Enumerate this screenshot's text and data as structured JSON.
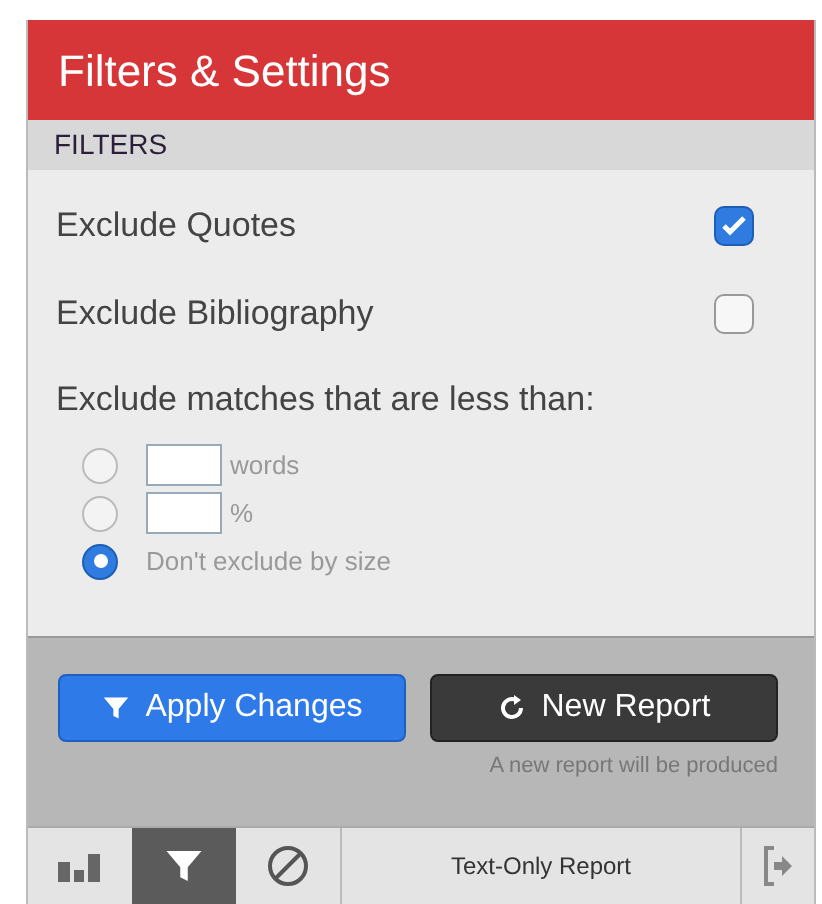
{
  "header": {
    "title": "Filters & Settings"
  },
  "section": {
    "title": "FILTERS"
  },
  "toggles": [
    {
      "label": "Exclude Quotes",
      "checked": true
    },
    {
      "label": "Exclude Bibliography",
      "checked": false
    }
  ],
  "size_filter": {
    "label": "Exclude matches that are less than:",
    "options": [
      {
        "kind": "input",
        "unit": "words",
        "selected": false
      },
      {
        "kind": "input",
        "unit": "%",
        "selected": false
      },
      {
        "kind": "plain",
        "label": "Don't exclude by size",
        "selected": true
      }
    ]
  },
  "actions": {
    "apply": "Apply Changes",
    "new_report": "New Report",
    "hint": "A new report will be produced"
  },
  "toolbar": {
    "tools": [
      {
        "kind": "chart",
        "selected": false
      },
      {
        "kind": "filter",
        "selected": true
      },
      {
        "kind": "exclude",
        "selected": false
      }
    ],
    "text_only": "Text-Only Report"
  }
}
